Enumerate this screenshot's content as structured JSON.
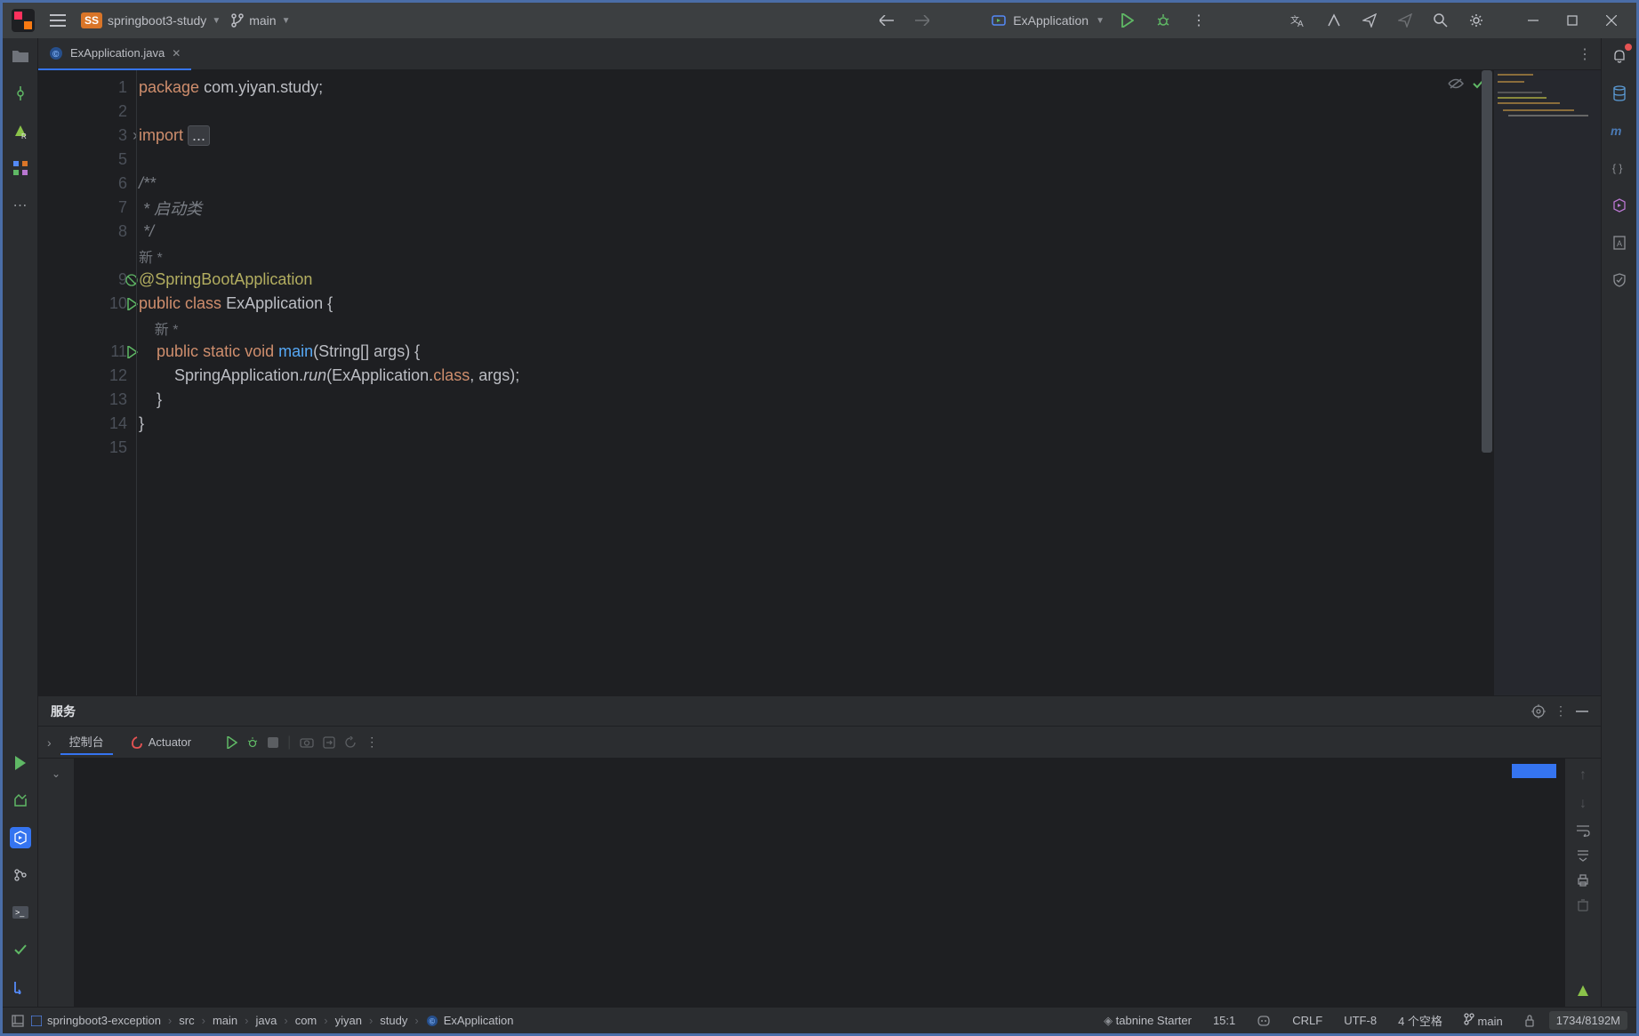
{
  "titlebar": {
    "project_name": "springboot3-study",
    "branch": "main",
    "run_config": "ExApplication"
  },
  "tab": {
    "filename": "ExApplication.java"
  },
  "editor": {
    "lines": {
      "l1_kw": "package",
      "l1_pkg": " com.yiyan.study;",
      "l3_kw": "import",
      "l3_fold": "...",
      "l6": "/**",
      "l7": " * 启动类",
      "l8": " */",
      "l8b_inlay": "新 *",
      "l9_ann": "@SpringBootApplication",
      "l10_kw1": "public",
      "l10_kw2": "class",
      "l10_cls": "ExApplication",
      "l10_brc": " {",
      "l10b_inlay": "    新 *",
      "l11_kw1": "public",
      "l11_kw2": "static",
      "l11_kw3": "void",
      "l11_mth": "main",
      "l11_p1": "(String[] args) {",
      "l12_a": "        SpringApplication.",
      "l12_run": "run",
      "l12_b": "(ExApplication.",
      "l12_kw": "class",
      "l12_c": ", args);",
      "l13": "    }",
      "l14": "}"
    },
    "line_nums": [
      "1",
      "2",
      "3",
      "5",
      "6",
      "7",
      "8",
      "",
      "9",
      "10",
      "",
      "11",
      "12",
      "13",
      "14",
      "15"
    ]
  },
  "services": {
    "title": "服务",
    "console_tab": "控制台",
    "actuator_tab": "Actuator"
  },
  "breadcrumbs": [
    "springboot3-exception",
    "src",
    "main",
    "java",
    "com",
    "yiyan",
    "study",
    "ExApplication"
  ],
  "status": {
    "tabnine": "tabnine Starter",
    "pos": "15:1",
    "sep": "CRLF",
    "enc": "UTF-8",
    "indent": "4 个空格",
    "branch": "main",
    "mem": "1734/8192M"
  }
}
